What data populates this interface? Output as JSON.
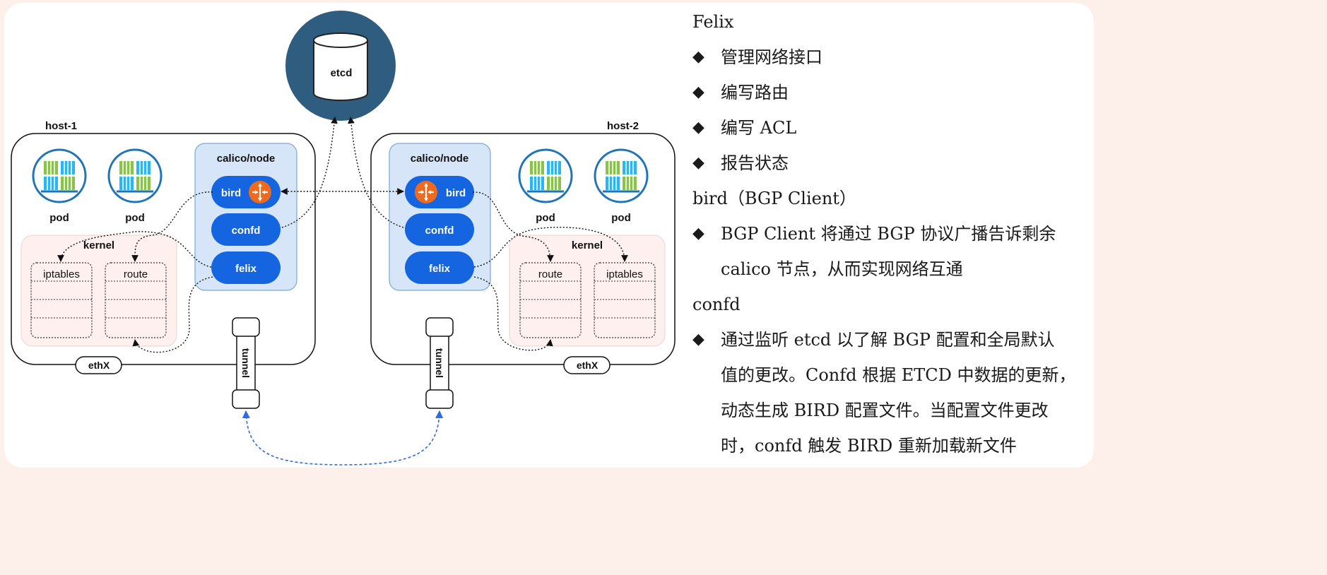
{
  "diagram": {
    "etcd_label": "etcd",
    "hosts": [
      {
        "name": "host-1",
        "calico_node_label": "calico/node",
        "components": [
          "bird",
          "confd",
          "felix"
        ],
        "pod_label": "pod",
        "kernel_label": "kernel",
        "tables": [
          "iptables",
          "route"
        ],
        "nic_label": "ethX"
      },
      {
        "name": "host-2",
        "calico_node_label": "calico/node",
        "components": [
          "bird",
          "confd",
          "felix"
        ],
        "pod_label": "pod",
        "kernel_label": "kernel",
        "tables": [
          "route",
          "iptables"
        ],
        "nic_label": "ethX"
      }
    ],
    "tunnel_label": "tunnel",
    "colors": {
      "etcd": "#2f5d80",
      "component": "#1565e0",
      "calico_bg": "#d6e6f8",
      "router_icon": "#f06a1d",
      "kernel_bg": "#fdf0ee",
      "tunnel_link": "#2c6be8"
    }
  },
  "notes": [
    {
      "type": "heading",
      "text": "Felix"
    },
    {
      "type": "bullet",
      "lines": [
        "管理网络接口"
      ]
    },
    {
      "type": "bullet",
      "lines": [
        "编写路由"
      ]
    },
    {
      "type": "bullet",
      "lines": [
        "编写 ACL"
      ]
    },
    {
      "type": "bullet",
      "lines": [
        "报告状态"
      ]
    },
    {
      "type": "heading",
      "text": "bird（BGP Client）"
    },
    {
      "type": "bullet",
      "lines": [
        "BGP Client 将通过 BGP 协议广播告诉剩余",
        "calico 节点，从而实现网络互通"
      ]
    },
    {
      "type": "heading",
      "text": "confd"
    },
    {
      "type": "bullet",
      "lines": [
        "通过监听 etcd 以了解 BGP 配置和全局默认",
        "值的更改。Confd 根据 ETCD 中数据的更新，",
        "动态生成 BIRD 配置文件。当配置文件更改",
        "时，confd 触发 BIRD 重新加载新文件"
      ]
    }
  ],
  "bullet_symbol": "◆"
}
